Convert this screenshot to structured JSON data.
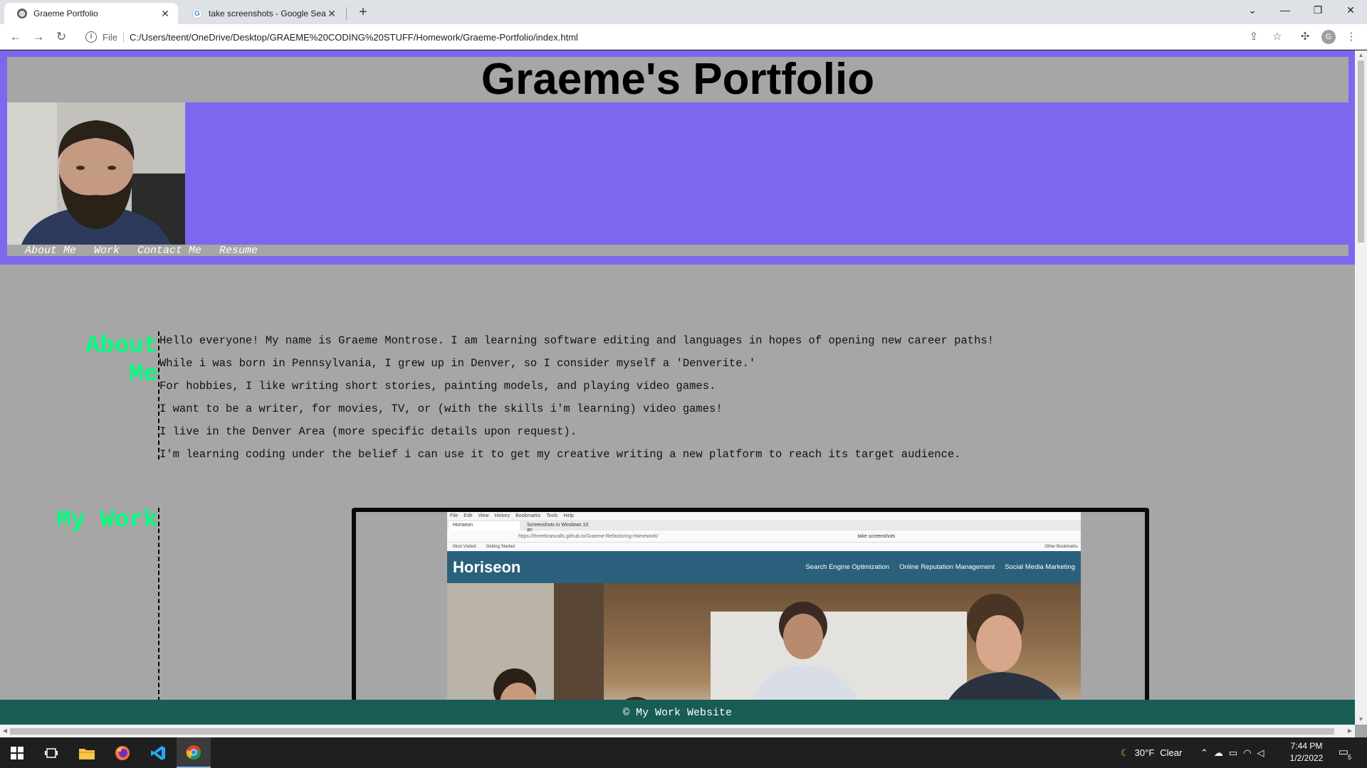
{
  "browser": {
    "tabs": [
      {
        "title": "Graeme Portfolio",
        "active": true
      },
      {
        "title": "take screenshots - Google Search",
        "active": false
      }
    ],
    "new_tab": "+",
    "window_controls": {
      "dropdown": "⌄",
      "minimize": "—",
      "restore": "❐",
      "close": "✕"
    },
    "url_scheme": "File",
    "url": "C:/Users/teent/OneDrive/Desktop/GRAEME%20CODING%20STUFF/Homework/Graeme-Portfolio/index.html",
    "profile_initial": "G"
  },
  "page": {
    "title": "Graeme's Portfolio",
    "nav": [
      "About Me",
      "Work",
      "Contact Me",
      "Resume"
    ],
    "about": {
      "heading_line1": "About",
      "heading_line2": "Me",
      "paragraphs": [
        "Hello everyone! My name is Graeme Montrose. I am learning software editing and languages in hopes of opening new career paths!",
        "While i was born in Pennsylvania, I grew up in Denver, so I consider myself a 'Denverite.'",
        "For hobbies, I like writing short stories, painting models, and playing video games.",
        "I want to be a writer, for movies, TV, or (with the skills i'm learning) video games!",
        "I live in the Denver Area (more specific details upon request).",
        "I'm learning coding under the belief i can use it to get my creative writing a new platform to reach its target audience."
      ]
    },
    "work": {
      "heading": "My Work",
      "screenshot": {
        "menu": [
          "File",
          "Edit",
          "View",
          "History",
          "Bookmarks",
          "Tools",
          "Help"
        ],
        "tab1": "Horiseon",
        "tab2": "Screenshots in Windows 10 an",
        "url": "https://threebrancalls.github.io/Graeme-Refactoring-Homework/",
        "search": "take screenshots",
        "bookmarks": [
          "Most Visited",
          "Getting Started"
        ],
        "other_bookmarks": "Other Bookmarks",
        "logo": "Horiseon",
        "links": [
          "Search Engine Optimization",
          "Online Reputation Management",
          "Social Media Marketing"
        ]
      }
    },
    "footer": "© My Work Website"
  },
  "taskbar": {
    "weather_temp": "30°F",
    "weather_desc": "Clear",
    "time": "7:44 PM",
    "date": "1/2/2022",
    "notifications": "5"
  },
  "colors": {
    "header_purple": "#7b68ee",
    "page_gray": "#a6a6a6",
    "heading_green": "#00ff7f",
    "footer_teal": "#185c55"
  }
}
